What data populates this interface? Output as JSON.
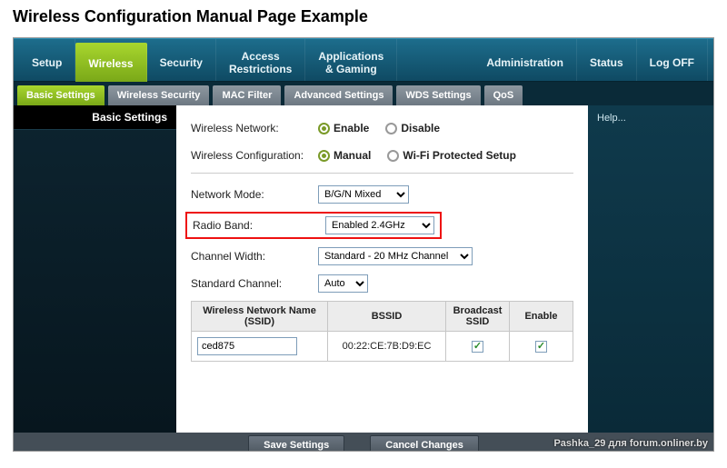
{
  "page_title": "Wireless Configuration Manual Page Example",
  "mainnav": {
    "setup": "Setup",
    "wireless": "Wireless",
    "security": "Security",
    "access": "Access\nRestrictions",
    "apps": "Applications\n& Gaming",
    "admin": "Administration",
    "status": "Status",
    "logoff": "Log OFF",
    "selected": "wireless"
  },
  "subnav": {
    "basic": "Basic Settings",
    "wsec": "Wireless Security",
    "mac": "MAC Filter",
    "adv": "Advanced Settings",
    "wds": "WDS Settings",
    "qos": "QoS",
    "selected": "basic"
  },
  "left_header": "Basic Settings",
  "help_label": "Help...",
  "form": {
    "wireless_network_label": "Wireless Network:",
    "wireless_network_enable": "Enable",
    "wireless_network_disable": "Disable",
    "wireless_config_label": "Wireless Configuration:",
    "wireless_config_manual": "Manual",
    "wireless_config_wps": "Wi-Fi Protected Setup",
    "network_mode_label": "Network Mode:",
    "network_mode_value": "B/G/N Mixed",
    "radio_band_label": "Radio Band:",
    "radio_band_value": "Enabled 2.4GHz",
    "channel_width_label": "Channel Width:",
    "channel_width_value": "Standard - 20 MHz Channel",
    "standard_channel_label": "Standard Channel:",
    "standard_channel_value": "Auto"
  },
  "ssid_table": {
    "col_name": "Wireless Network Name (SSID)",
    "col_bssid": "BSSID",
    "col_broadcast": "Broadcast SSID",
    "col_enable": "Enable",
    "row": {
      "ssid": "ced875",
      "bssid": "00:22:CE:7B:D9:EC",
      "broadcast": true,
      "enable": true
    }
  },
  "buttons": {
    "save": "Save Settings",
    "cancel": "Cancel Changes"
  },
  "watermark": "Pashka_29 для forum.onliner.by"
}
